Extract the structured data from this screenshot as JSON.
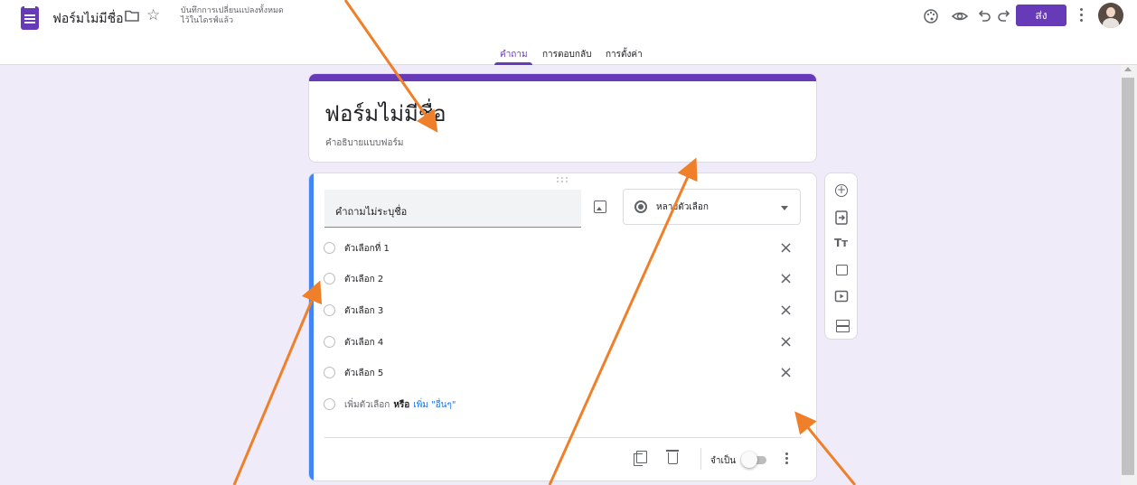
{
  "header": {
    "doc_title": "ฟอร์มไม่มีชื่อ",
    "save_status": "บันทึกการเปลี่ยนแปลงทั้งหมดไว้ในไดรฟ์แล้ว",
    "send_label": "ส่ง",
    "icons": [
      "palette-icon",
      "eye-icon",
      "undo-icon",
      "redo-icon",
      "more-vert-icon"
    ]
  },
  "tabs": [
    {
      "label": "คำถาม",
      "active": true
    },
    {
      "label": "การตอบกลับ",
      "active": false
    },
    {
      "label": "การตั้งค่า",
      "active": false
    }
  ],
  "form": {
    "title": "ฟอร์มไม่มีชื่อ",
    "description": "คำอธิบายแบบฟอร์ม"
  },
  "question": {
    "title": "คำถามไม่ระบุชื่อ",
    "type": "หลายตัวเลือก",
    "options": [
      "ตัวเลือกที่ 1",
      "ตัวเลือก 2",
      "ตัวเลือก 3",
      "ตัวเลือก 4",
      "ตัวเลือก 5"
    ],
    "add_option": "เพิ่มตัวเลือก",
    "or": "หรือ",
    "add_other": "เพิ่ม \"อื่นๆ\"",
    "required_label": "จำเป็น"
  },
  "colors": {
    "accent": "#673ab7",
    "background": "#f0ebf8",
    "active_bar": "#4285f4",
    "arrow": "#f07f2a"
  }
}
